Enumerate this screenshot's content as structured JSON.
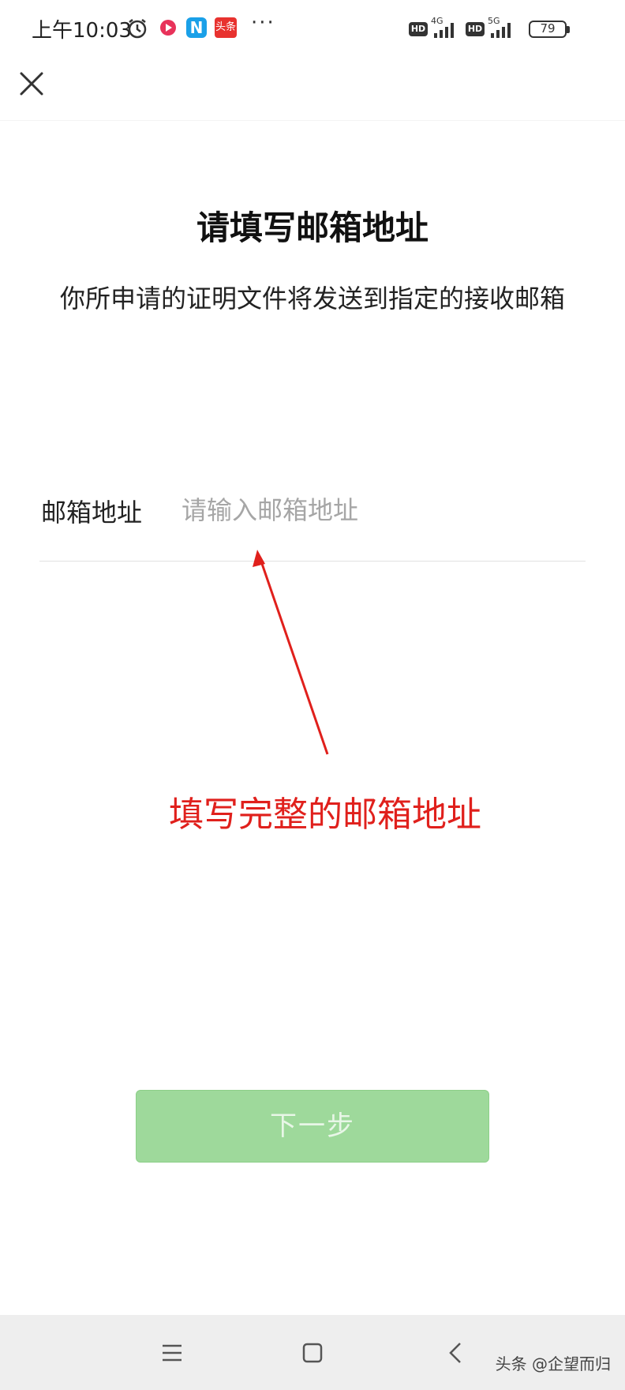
{
  "status_bar": {
    "time": "上午10:03",
    "app_badge_n": "N",
    "app_badge_toutiao": "头条",
    "more": "···",
    "hd1": "HD",
    "net1": "4G",
    "hd2": "HD",
    "net2": "5G",
    "battery": "79"
  },
  "header": {
    "close_icon": "close-icon"
  },
  "page": {
    "title": "请填写邮箱地址",
    "description": "你所申请的证明文件将发送到指定的接收邮箱"
  },
  "form": {
    "email_label": "邮箱地址",
    "email_value": "",
    "email_placeholder": "请输入邮箱地址"
  },
  "annotation": {
    "text": "填写完整的邮箱地址",
    "color": "#e0201c"
  },
  "actions": {
    "next_label": "下一步",
    "next_color": "#9ed99b"
  },
  "nav_bar": {
    "menu_icon": "menu-icon",
    "home_icon": "home-icon",
    "back_icon": "back-icon",
    "watermark": "头条 @企望而归"
  }
}
